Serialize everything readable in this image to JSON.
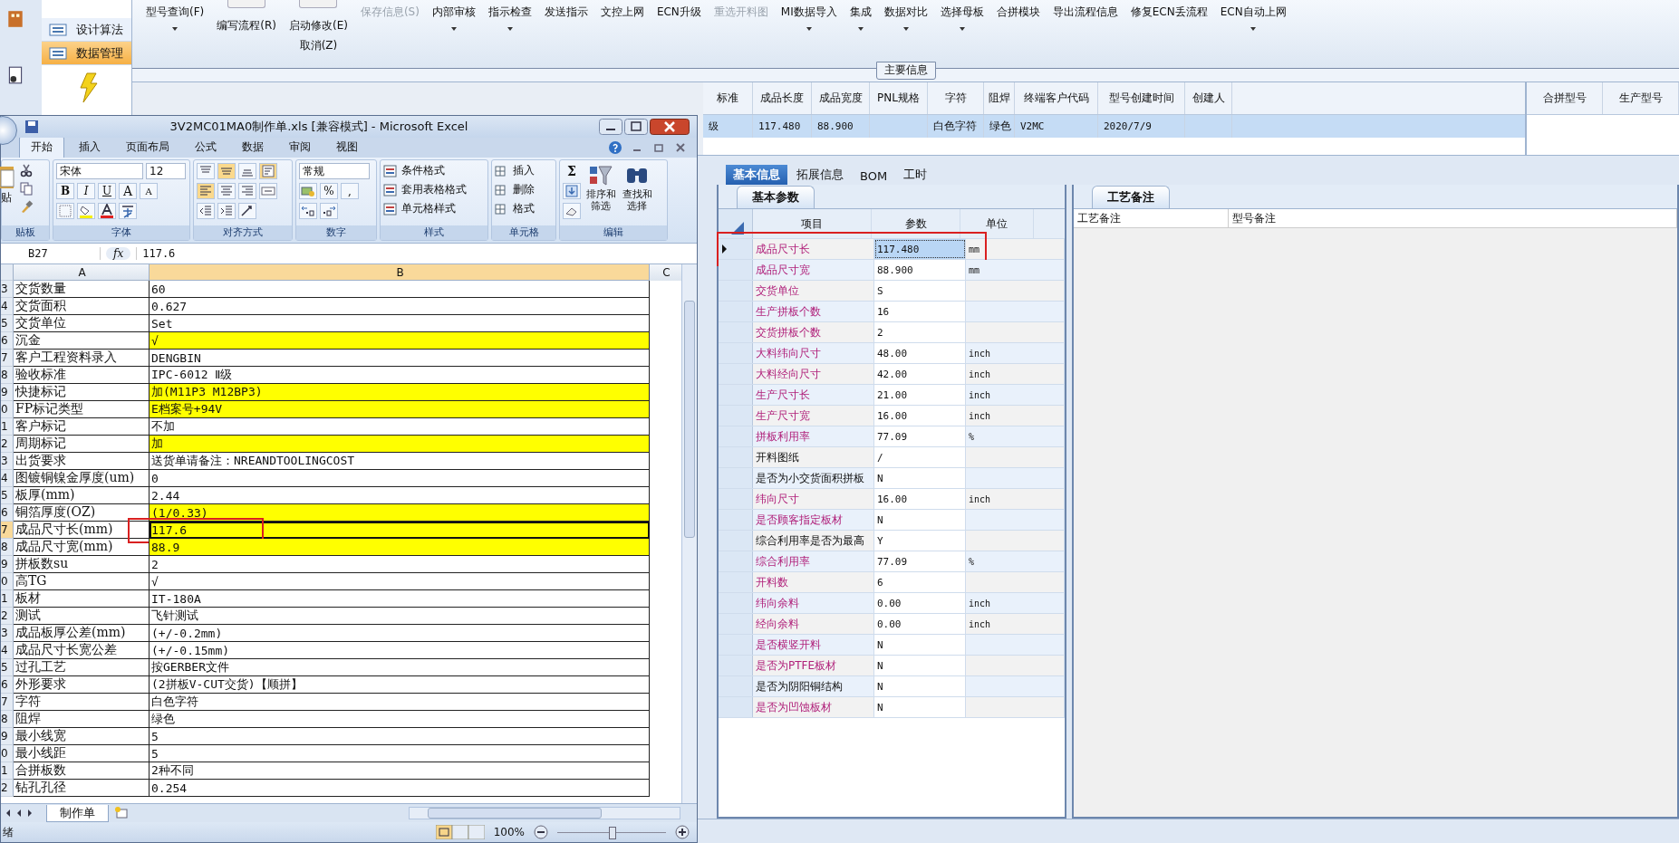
{
  "sidebar": {
    "items": [
      {
        "label": "设计算法",
        "selected": false
      },
      {
        "label": "数据管理",
        "selected": true
      }
    ]
  },
  "toolbar": {
    "buttons": [
      {
        "kind": "button",
        "label": "型号查询(F)",
        "disabled": false,
        "dropdown": true
      },
      {
        "kind": "toggle",
        "label": "编写流程(R)",
        "on": false,
        "disabled": false,
        "dropdown": false
      },
      {
        "kind": "toggle",
        "label": "启动修改(E)",
        "sublabel": "取消(Z)",
        "on": false,
        "disabled": false,
        "dropdown": false
      },
      {
        "kind": "button",
        "label": "保存信息(S)",
        "disabled": true,
        "dropdown": false
      },
      {
        "kind": "button",
        "label": "内部审核",
        "disabled": false,
        "dropdown": true
      },
      {
        "kind": "button",
        "label": "指示检查",
        "disabled": false,
        "dropdown": true
      },
      {
        "kind": "button",
        "label": "发送指示",
        "disabled": false,
        "dropdown": false
      },
      {
        "kind": "button",
        "label": "文控上网",
        "disabled": false,
        "dropdown": false
      },
      {
        "kind": "button",
        "label": "ECN升级",
        "disabled": false,
        "dropdown": false
      },
      {
        "kind": "button",
        "label": "重选开料图",
        "disabled": true,
        "dropdown": false
      },
      {
        "kind": "button",
        "label": "MI数据导入",
        "disabled": false,
        "dropdown": true
      },
      {
        "kind": "button",
        "label": "集成",
        "disabled": false,
        "dropdown": true
      },
      {
        "kind": "button",
        "label": "数据对比",
        "disabled": false,
        "dropdown": true
      },
      {
        "kind": "button",
        "label": "选择母板",
        "disabled": false,
        "dropdown": true
      },
      {
        "kind": "button",
        "label": "合拼模块",
        "disabled": false,
        "dropdown": false
      },
      {
        "kind": "button",
        "label": "导出流程信息",
        "disabled": false,
        "dropdown": false
      },
      {
        "kind": "button",
        "label": "修复ECN丢流程",
        "disabled": false,
        "dropdown": false
      },
      {
        "kind": "button",
        "label": "ECN自动上网",
        "disabled": false,
        "dropdown": true
      }
    ]
  },
  "group_title": "主要信息",
  "main_grid": {
    "columns": [
      "标准",
      "成品长度",
      "成品宽度",
      "PNL规格",
      "字符",
      "阻焊",
      "终端客户代码",
      "型号创建时间",
      "创建人"
    ],
    "rows": [
      {
        "selected": true,
        "cells": [
          "级",
          "117.480",
          "88.900",
          "",
          "白色字符",
          "绿色",
          "V2MC",
          "2020/7/9",
          ""
        ]
      }
    ]
  },
  "side_grid": {
    "columns": [
      "合拼型号",
      "生产型号"
    ]
  },
  "detail_tabs": [
    {
      "label": "基本信息",
      "selected": true
    },
    {
      "label": "拓展信息",
      "selected": false
    },
    {
      "label": "BOM",
      "selected": false
    },
    {
      "label": "工时",
      "selected": false
    }
  ],
  "param_tab": "基本参数",
  "param_table": {
    "columns": [
      "项目",
      "参数",
      "单位"
    ],
    "rows": [
      {
        "label": "成品尺寸长",
        "value": "117.480",
        "unit": "mm",
        "emphasized": true,
        "selected": true,
        "annotated": true
      },
      {
        "label": "成品尺寸宽",
        "value": "88.900",
        "unit": "mm",
        "emphasized": true,
        "selected": false,
        "annotated": false
      },
      {
        "label": "交货单位",
        "value": "S",
        "emphasized": true,
        "selected": false,
        "annotated": false
      },
      {
        "label": "生产拼板个数",
        "value": "16",
        "emphasized": true,
        "selected": false,
        "annotated": false
      },
      {
        "label": "交货拼板个数",
        "value": "2",
        "emphasized": true,
        "selected": false,
        "annotated": false
      },
      {
        "label": "大料纬向尺寸",
        "value": "48.00",
        "unit": "inch",
        "emphasized": true,
        "selected": false,
        "annotated": false
      },
      {
        "label": "大料经向尺寸",
        "value": "42.00",
        "unit": "inch",
        "emphasized": true,
        "selected": false,
        "annotated": false
      },
      {
        "label": "生产尺寸长",
        "value": "21.00",
        "unit": "inch",
        "emphasized": true,
        "selected": false,
        "annotated": false
      },
      {
        "label": "生产尺寸宽",
        "value": "16.00",
        "unit": "inch",
        "emphasized": true,
        "selected": false,
        "annotated": false
      },
      {
        "label": "拼板利用率",
        "value": "77.09",
        "unit": "%",
        "emphasized": true,
        "selected": false,
        "annotated": false
      },
      {
        "label": "开料图纸",
        "value": "/",
        "emphasized": false,
        "selected": false,
        "annotated": false
      },
      {
        "label": "是否为小交货面积拼板",
        "value": "N",
        "emphasized": false,
        "selected": false,
        "annotated": false
      },
      {
        "label": "纬向尺寸",
        "value": "16.00",
        "unit": "inch",
        "emphasized": true,
        "selected": false,
        "annotated": false
      },
      {
        "label": "是否顾客指定板材",
        "value": "N",
        "emphasized": true,
        "selected": false,
        "annotated": false
      },
      {
        "label": "综合利用率是否为最高",
        "value": "Y",
        "emphasized": false,
        "selected": false,
        "annotated": false
      },
      {
        "label": "综合利用率",
        "value": "77.09",
        "unit": "%",
        "emphasized": true,
        "selected": false,
        "annotated": false
      },
      {
        "label": "开料数",
        "value": "6",
        "emphasized": true,
        "selected": false,
        "annotated": false
      },
      {
        "label": "纬向余料",
        "value": "0.00",
        "unit": "inch",
        "emphasized": true,
        "selected": false,
        "annotated": false
      },
      {
        "label": "经向余料",
        "value": "0.00",
        "unit": "inch",
        "emphasized": true,
        "selected": false,
        "annotated": false
      },
      {
        "label": "是否横竖开料",
        "value": "N",
        "emphasized": true,
        "selected": false,
        "annotated": false
      },
      {
        "label": "是否为PTFE板材",
        "value": "N",
        "emphasized": true,
        "selected": false,
        "annotated": false
      },
      {
        "label": "是否为阴阳铜结构",
        "value": "N",
        "emphasized": false,
        "selected": false,
        "annotated": false
      },
      {
        "label": "是否为凹蚀板材",
        "value": "N",
        "emphasized": true,
        "selected": false,
        "annotated": false
      }
    ]
  },
  "notes_panel": {
    "tab": "工艺备注",
    "columns": [
      "工艺备注",
      "型号备注"
    ]
  },
  "excel": {
    "title": "3V2MC01MA0制作单.xls  [兼容模式] - Microsoft Excel",
    "tabs": [
      {
        "label": "开始",
        "selected": true
      },
      {
        "label": "插入",
        "selected": false
      },
      {
        "label": "页面布局",
        "selected": false
      },
      {
        "label": "公式",
        "selected": false
      },
      {
        "label": "数据",
        "selected": false
      },
      {
        "label": "审阅",
        "selected": false
      },
      {
        "label": "视图",
        "selected": false
      }
    ],
    "clipboard": {
      "paste": "贴",
      "label": "贴板"
    },
    "font": {
      "name": "宋体",
      "size": "12",
      "bold": "B",
      "italic": "I",
      "underline": "U",
      "grow": "A",
      "shrink": "A",
      "label": "字体"
    },
    "alignment": {
      "label": "对齐方式"
    },
    "number": {
      "format": "常规",
      "percent": "%",
      "comma": ",",
      "label": "数字"
    },
    "styles": {
      "items": [
        "条件格式",
        "套用表格格式",
        "单元格样式"
      ],
      "label": "样式"
    },
    "cells": {
      "items": [
        "插入",
        "删除",
        "格式"
      ],
      "label": "单元格"
    },
    "editing": {
      "sum": "Σ",
      "sort": "排序和筛选",
      "find": "查找和选择",
      "label": "编辑"
    },
    "name_box": "B27",
    "fx": "fx",
    "formula": "117.6",
    "columns": [
      "A",
      "B",
      "C"
    ],
    "rows": [
      {
        "num": "3",
        "a": "交货数量",
        "b": "60",
        "highlighted": false,
        "selected": false,
        "annotated": false
      },
      {
        "num": "4",
        "a": "交货面积",
        "b": "0.627",
        "highlighted": false,
        "selected": false,
        "annotated": false
      },
      {
        "num": "5",
        "a": "交货单位",
        "b": "Set",
        "highlighted": false,
        "selected": false,
        "annotated": false
      },
      {
        "num": "6",
        "a": "沉金",
        "b": "√",
        "highlighted": true,
        "selected": false,
        "annotated": false
      },
      {
        "num": "7",
        "a": "客户工程资料录入",
        "b": "DENGBIN",
        "highlighted": false,
        "selected": false,
        "annotated": false
      },
      {
        "num": "8",
        "a": "验收标准",
        "b": "IPC-6012 Ⅱ级",
        "highlighted": false,
        "selected": false,
        "annotated": false
      },
      {
        "num": "9",
        "a": "快捷标记",
        "b": "加(M11P3 M12BP3)",
        "highlighted": true,
        "selected": false,
        "annotated": false
      },
      {
        "num": "0",
        "a": "FP标记类型",
        "b": "E档案号+94V",
        "highlighted": true,
        "selected": false,
        "annotated": false
      },
      {
        "num": "1",
        "a": "客户标记",
        "b": "不加",
        "highlighted": false,
        "selected": false,
        "annotated": false
      },
      {
        "num": "2",
        "a": "周期标记",
        "b": "加",
        "highlighted": true,
        "selected": false,
        "annotated": false
      },
      {
        "num": "3",
        "a": "出货要求",
        "b": "送货单请备注：NREANDTOOLINGCOST",
        "highlighted": false,
        "selected": false,
        "annotated": false
      },
      {
        "num": "4",
        "a": "图镀铜镍金厚度(um)",
        "b": "0",
        "highlighted": false,
        "selected": false,
        "annotated": false
      },
      {
        "num": "5",
        "a": "板厚(mm)",
        "b": "2.44",
        "highlighted": false,
        "selected": false,
        "annotated": false
      },
      {
        "num": "6",
        "a": "铜箔厚度(OZ)",
        "b": "(1/0.33)",
        "highlighted": true,
        "selected": false,
        "annotated": false
      },
      {
        "num": "7",
        "a": "成品尺寸长(mm)",
        "b": "117.6",
        "highlighted": true,
        "selected": true,
        "annotated": true
      },
      {
        "num": "8",
        "a": "成品尺寸宽(mm)",
        "b": "88.9",
        "highlighted": true,
        "selected": false,
        "annotated": false
      },
      {
        "num": "9",
        "a": "拼板数su",
        "b": "2",
        "highlighted": false,
        "selected": false,
        "annotated": false
      },
      {
        "num": "0",
        "a": "高TG",
        "b": "√",
        "highlighted": false,
        "selected": false,
        "annotated": false
      },
      {
        "num": "1",
        "a": "板材",
        "b": "IT-180A",
        "highlighted": false,
        "selected": false,
        "annotated": false
      },
      {
        "num": "2",
        "a": "测试",
        "b": "飞针测试",
        "highlighted": false,
        "selected": false,
        "annotated": false
      },
      {
        "num": "3",
        "a": "成品板厚公差(mm)",
        "b": "(+/-0.2mm)",
        "highlighted": false,
        "selected": false,
        "annotated": false
      },
      {
        "num": "4",
        "a": "成品尺寸长宽公差",
        "b": "(+/-0.15mm)",
        "highlighted": false,
        "selected": false,
        "annotated": false
      },
      {
        "num": "5",
        "a": "过孔工艺",
        "b": "按GERBER文件",
        "highlighted": false,
        "selected": false,
        "annotated": false
      },
      {
        "num": "6",
        "a": "外形要求",
        "b": "(2拼板V-CUT交货)【顺拼】",
        "highlighted": false,
        "selected": false,
        "annotated": false
      },
      {
        "num": "7",
        "a": "字符",
        "b": "白色字符",
        "highlighted": false,
        "selected": false,
        "annotated": false
      },
      {
        "num": "8",
        "a": "阻焊",
        "b": "绿色",
        "highlighted": false,
        "selected": false,
        "annotated": false
      },
      {
        "num": "9",
        "a": "最小线宽",
        "b": "5",
        "highlighted": false,
        "selected": false,
        "annotated": false
      },
      {
        "num": "0",
        "a": "最小线距",
        "b": "5",
        "highlighted": false,
        "selected": false,
        "annotated": false
      },
      {
        "num": "1",
        "a": "合拼板数",
        "b": "2种不同",
        "highlighted": false,
        "selected": false,
        "annotated": false
      },
      {
        "num": "2",
        "a": "钻孔孔径",
        "b": "0.254",
        "highlighted": false,
        "selected": false,
        "annotated": false
      }
    ],
    "sheet_tab": "制作单",
    "status": "绪",
    "zoom": "100%",
    "zoom_slider": {
      "level": 0.5
    }
  }
}
